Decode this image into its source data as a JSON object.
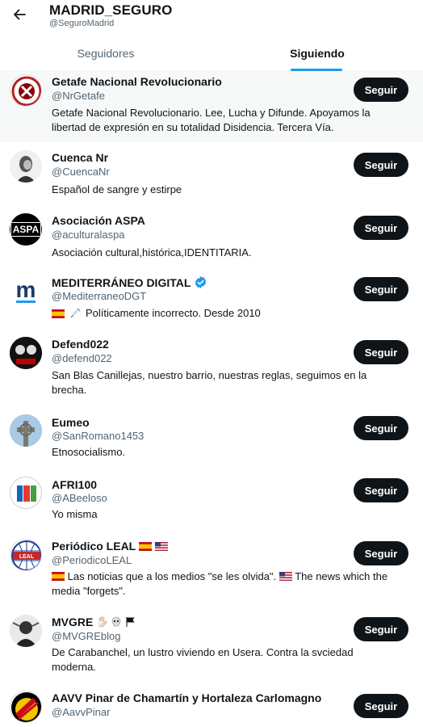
{
  "header": {
    "title": "MADRID_SEGURO",
    "handle": "@SeguroMadrid"
  },
  "tabs": [
    {
      "label": "Seguidores",
      "active": false
    },
    {
      "label": "Siguiendo",
      "active": true
    }
  ],
  "colors": {
    "accent": "#1d9bf0",
    "button_bg": "#0f1419",
    "text_secondary": "#536471"
  },
  "accounts": [
    {
      "name": "Getafe Nacional Revolucionario",
      "handle": "@NrGetafe",
      "bio": "Getafe Nacional Revolucionario. Lee, Lucha y Difunde. Apoyamos la libertad de expresión en su totalidad Disidencia. Tercera Vía.",
      "button": "Seguir"
    },
    {
      "name": "Cuenca Nr",
      "handle": "@CuencaNr",
      "bio": "Español de sangre y estirpe",
      "button": "Seguir"
    },
    {
      "name": "Asociación ASPA",
      "handle": "@aculturalaspa",
      "bio": "Asociación cultural,histórica,IDENTITARIA.",
      "button": "Seguir",
      "avatar_text": "ASPA"
    },
    {
      "name": "MEDITERRÁNEO DIGITAL",
      "handle": "@MediterraneoDGT",
      "bio": "Políticamente incorrecto. Desde 2010",
      "button": "Seguir",
      "verified": true,
      "avatar_text": "m"
    },
    {
      "name": "Defend022",
      "handle": "@defend022",
      "bio": "San Blas Canillejas, nuestro barrio, nuestras reglas, seguimos en la brecha.",
      "button": "Seguir"
    },
    {
      "name": "Eumeo",
      "handle": "@SanRomano1453",
      "bio": "Etnosocialismo.",
      "button": "Seguir"
    },
    {
      "name": "AFRI100",
      "handle": "@ABeeloso",
      "bio": "Yo misma",
      "button": "Seguir"
    },
    {
      "name": "Periódico LEAL",
      "handle": "@PeriodicoLEAL",
      "bio_es": "Las noticias que a los medios \"se les olvida\".",
      "bio_en": "The news which the media \"forgets\".",
      "button": "Seguir",
      "avatar_text": "LEAL"
    },
    {
      "name": "MVGRE",
      "handle": "@MVGREblog",
      "bio": "De Carabanchel, un lustro viviendo en Usera. Contra la svciedad moderna.",
      "button": "Seguir"
    },
    {
      "name": "AAVV Pinar de Chamartín y Hortaleza Carlomagno",
      "handle": "@AavvPinar",
      "bio": "",
      "button": "Seguir"
    }
  ]
}
